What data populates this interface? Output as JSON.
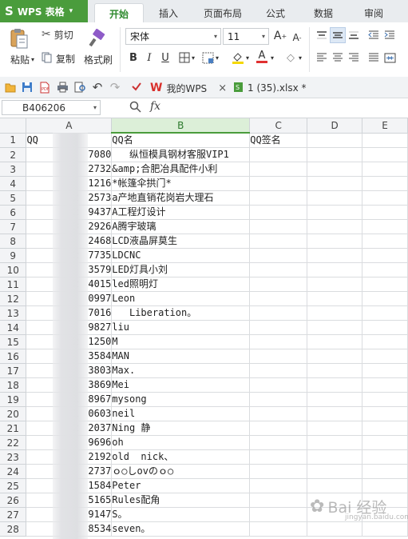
{
  "app": {
    "logo": "S",
    "title": "WPS 表格",
    "menu_arrow": "▾"
  },
  "tabs": [
    {
      "label": "开始",
      "active": true
    },
    {
      "label": "插入"
    },
    {
      "label": "页面布局"
    },
    {
      "label": "公式"
    },
    {
      "label": "数据"
    },
    {
      "label": "审阅"
    }
  ],
  "ribbon": {
    "paste": "粘贴",
    "cut": "剪切",
    "copy": "复制",
    "format_painter": "格式刷",
    "font_name": "宋体",
    "font_size": "11",
    "bold": "B",
    "italic": "I",
    "underline": "U",
    "font_color_letter": "A",
    "grow_font": "A",
    "shrink_font": "A",
    "font_color": "#e03030",
    "highlight_color": "#f5d800"
  },
  "quickbar": {
    "doc_tab_1": "我的WPS",
    "doc_tab_2": "1 (35).xlsx *",
    "close": "×"
  },
  "formula_bar": {
    "cell_ref": "B406206",
    "fx": "fx"
  },
  "columns": [
    "A",
    "B",
    "C",
    "D",
    "E"
  ],
  "selected_column": "B",
  "rows": [
    {
      "n": "1",
      "a": "QQ",
      "b": "QQ名",
      "c": "QQ签名",
      "header": true
    },
    {
      "n": "2",
      "a": "7080",
      "b": "   纵恒模具钢材客服VIP1"
    },
    {
      "n": "3",
      "a": "2732",
      "b": "&amp;合肥冶具配件小利"
    },
    {
      "n": "4",
      "a": "1216",
      "b": "*帐篷伞拱门*"
    },
    {
      "n": "5",
      "p": "2",
      "a": "2573",
      "b": "a产地直销花岗岩大理石"
    },
    {
      "n": "6",
      "p": "2",
      "a": "9437",
      "b": "A工程灯设计"
    },
    {
      "n": "7",
      "p": "3",
      "a": "2926",
      "b": "A腾宇玻璃"
    },
    {
      "n": "8",
      "a": "2468",
      "b": "LCD液晶屏莫生"
    },
    {
      "n": "9",
      "p": "2",
      "a": "7735",
      "b": "LDCNC"
    },
    {
      "n": "10",
      "a": "3579",
      "b": "LED灯具小刘"
    },
    {
      "n": "11",
      "p": "2",
      "a": "4015",
      "b": "led照明灯"
    },
    {
      "n": "12",
      "a": "0997",
      "b": "Leon"
    },
    {
      "n": "13",
      "a": "7016",
      "b": "   Liberation。"
    },
    {
      "n": "14",
      "a": "9827",
      "b": "liu"
    },
    {
      "n": "15",
      "p": "2",
      "a": "1250",
      "b": "M"
    },
    {
      "n": "16",
      "a": "3584",
      "b": "MAN"
    },
    {
      "n": "17",
      "a": "3803",
      "b": "Max."
    },
    {
      "n": "18",
      "a": "3869",
      "b": "Mei"
    },
    {
      "n": "19",
      "p": "1",
      "a": "8967",
      "b": "mysong"
    },
    {
      "n": "20",
      "p": "1",
      "a": "0603",
      "b": "neil"
    },
    {
      "n": "21",
      "p": "2",
      "a": "2037",
      "b": "Ning 静"
    },
    {
      "n": "22",
      "a": "9696",
      "b": "oh"
    },
    {
      "n": "23",
      "a": "2192",
      "b": "old  nick、"
    },
    {
      "n": "24",
      "a": "2737",
      "b": "ｏ○しovのｏ○"
    },
    {
      "n": "25",
      "a": "1584",
      "b": "Peter"
    },
    {
      "n": "26",
      "a": "5165",
      "b": "Rules配角"
    },
    {
      "n": "27",
      "a": "9147",
      "b": "S。"
    },
    {
      "n": "28",
      "p": "1",
      "a": "8534",
      "b": "seven。"
    }
  ],
  "watermark": {
    "text": "Bai 经验",
    "sub": "jingyan.baidu.com"
  }
}
